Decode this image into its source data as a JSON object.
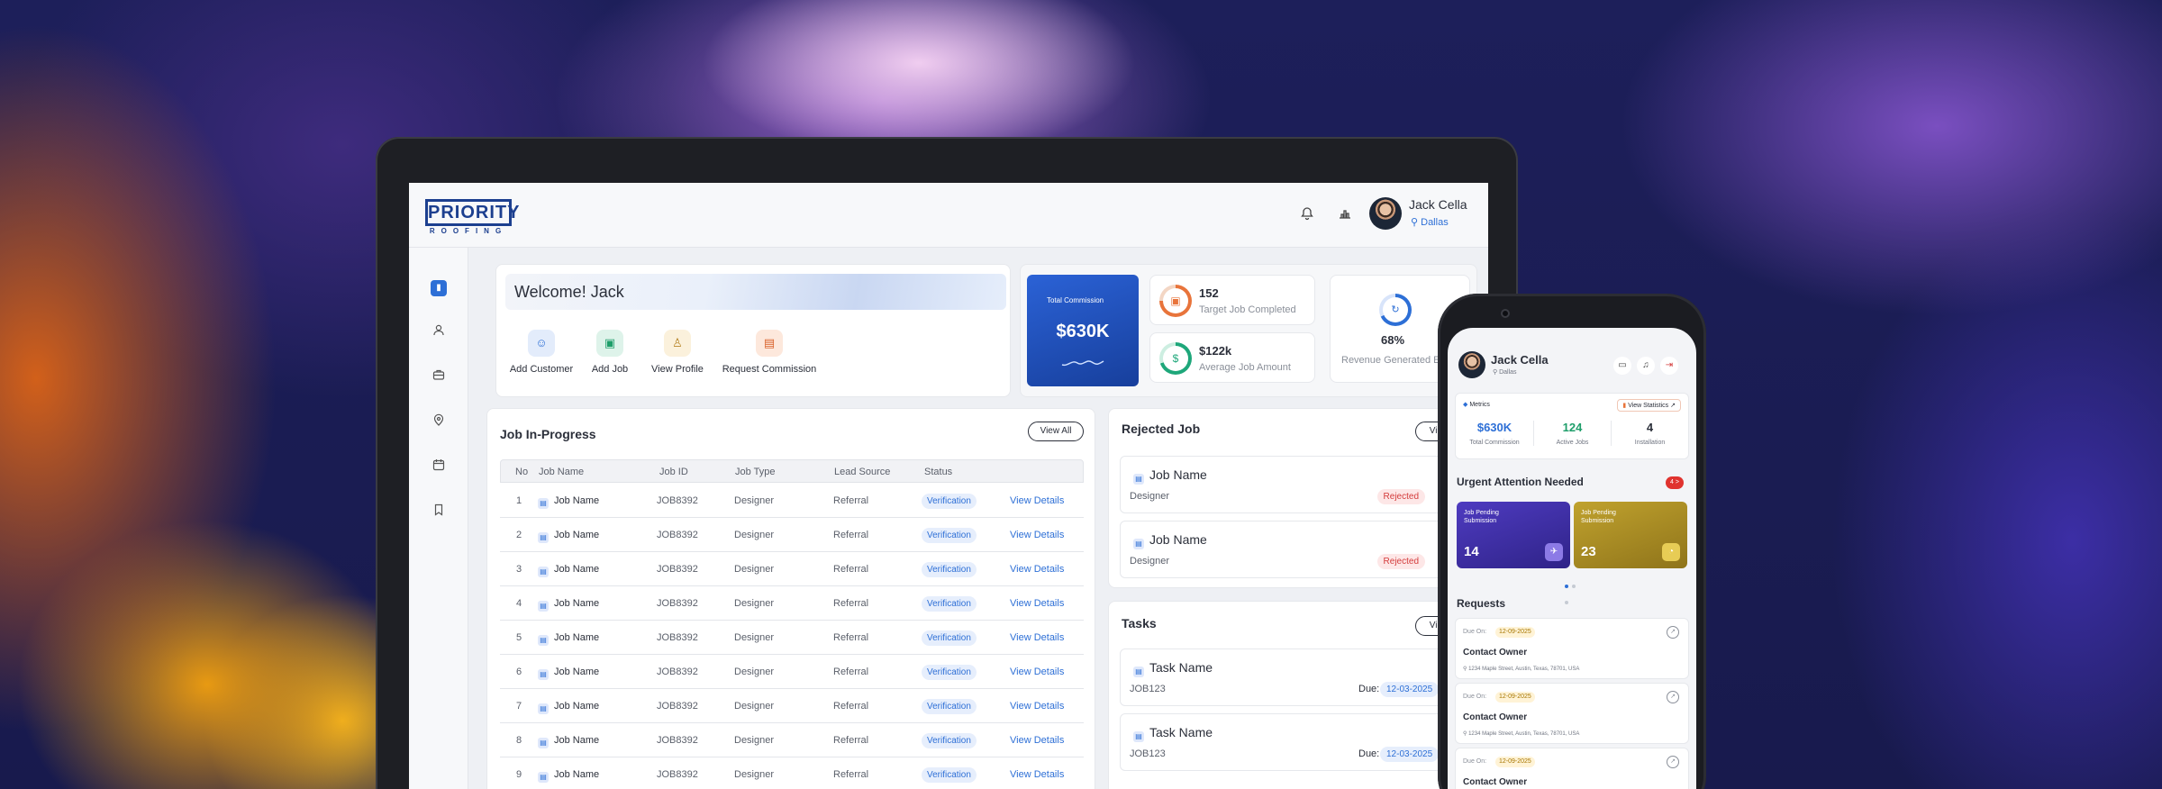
{
  "brand": {
    "logo_line1": "PRIORITY",
    "logo_line2": "ROOFING",
    "primary_color": "#2d6fd6"
  },
  "header": {
    "user_name": "Jack Cella",
    "user_location": "Dallas"
  },
  "icons": {
    "bell": "bell-icon",
    "chart": "chart-icon",
    "location": "location-pin-icon",
    "document": "document-icon"
  },
  "welcome": {
    "title": "Welcome! Jack",
    "actions": [
      {
        "label": "Add Customer",
        "icon": "user-icon"
      },
      {
        "label": "Add Job",
        "icon": "briefcase-icon"
      },
      {
        "label": "View Profile",
        "icon": "profile-icon"
      },
      {
        "label": "Request Commission",
        "icon": "wallet-icon"
      }
    ]
  },
  "stats": {
    "commission_label": "Total Commission",
    "commission_value": "$630K",
    "target_value": "152",
    "target_label": "Target Job Completed",
    "avg_value": "$122k",
    "avg_label": "Average Job Amount",
    "revenue_value": "68%",
    "revenue_label": "Revenue Generated E"
  },
  "jobs": {
    "title": "Job In-Progress",
    "view_all": "View All",
    "columns": [
      "No",
      "Job Name",
      "Job ID",
      "Job Type",
      "Lead Source",
      "Status"
    ],
    "rows": [
      {
        "no": "1",
        "name": "Job Name",
        "id": "JOB8392",
        "type": "Designer",
        "source": "Referral",
        "status": "Verification",
        "action": "View Details"
      },
      {
        "no": "2",
        "name": "Job Name",
        "id": "JOB8392",
        "type": "Designer",
        "source": "Referral",
        "status": "Verification",
        "action": "View Details"
      },
      {
        "no": "3",
        "name": "Job Name",
        "id": "JOB8392",
        "type": "Designer",
        "source": "Referral",
        "status": "Verification",
        "action": "View Details"
      },
      {
        "no": "4",
        "name": "Job Name",
        "id": "JOB8392",
        "type": "Designer",
        "source": "Referral",
        "status": "Verification",
        "action": "View Details"
      },
      {
        "no": "5",
        "name": "Job Name",
        "id": "JOB8392",
        "type": "Designer",
        "source": "Referral",
        "status": "Verification",
        "action": "View Details"
      },
      {
        "no": "6",
        "name": "Job Name",
        "id": "JOB8392",
        "type": "Designer",
        "source": "Referral",
        "status": "Verification",
        "action": "View Details"
      },
      {
        "no": "7",
        "name": "Job Name",
        "id": "JOB8392",
        "type": "Designer",
        "source": "Referral",
        "status": "Verification",
        "action": "View Details"
      },
      {
        "no": "8",
        "name": "Job Name",
        "id": "JOB8392",
        "type": "Designer",
        "source": "Referral",
        "status": "Verification",
        "action": "View Details"
      },
      {
        "no": "9",
        "name": "Job Name",
        "id": "JOB8392",
        "type": "Designer",
        "source": "Referral",
        "status": "Verification",
        "action": "View Details"
      }
    ]
  },
  "rejected": {
    "title": "Rejected Job",
    "view_all": "View A",
    "items": [
      {
        "name": "Job Name",
        "type": "Designer",
        "status": "Rejected"
      },
      {
        "name": "Job Name",
        "type": "Designer",
        "status": "Rejected"
      }
    ]
  },
  "tasks": {
    "title": "Tasks",
    "view_all": "View A",
    "due_label": "Due:",
    "items": [
      {
        "name": "Task Name",
        "id": "JOB123",
        "due": "12-03-2025"
      },
      {
        "name": "Task Name",
        "id": "JOB123",
        "due": "12-03-2025"
      }
    ]
  },
  "mobile": {
    "user_name": "Jack Cella",
    "user_location": "Dallas",
    "metrics_label": "Metrics",
    "view_statistics": "View Statistics ↗",
    "metrics": [
      {
        "value": "$630K",
        "label": "Total Commission",
        "color": "#2d6fd6"
      },
      {
        "value": "124",
        "label": "Active Jobs",
        "color": "#1e9e6a"
      },
      {
        "value": "4",
        "label": "Installation",
        "color": "#2b2f3a"
      }
    ],
    "urgent_title": "Urgent Attention Needed",
    "urgent_badge": "4 >",
    "urgent_cards": [
      {
        "title": "Job Pending Submission",
        "value": "14",
        "color": "#3b2c9e"
      },
      {
        "title": "Job Pending Submission",
        "value": "23",
        "color": "#a88a1e"
      }
    ],
    "requests_title": "Requests",
    "requests": [
      {
        "due_label": "Due On:",
        "due": "12-09-2025",
        "title": "Contact Owner",
        "address": "1234 Maple Street, Austin, Texas, 78701, USA"
      },
      {
        "due_label": "Due On:",
        "due": "12-09-2025",
        "title": "Contact Owner",
        "address": "1234 Maple Street, Austin, Texas, 78701, USA"
      },
      {
        "due_label": "Due On:",
        "due": "12-09-2025",
        "title": "Contact Owner",
        "address": ""
      }
    ]
  }
}
